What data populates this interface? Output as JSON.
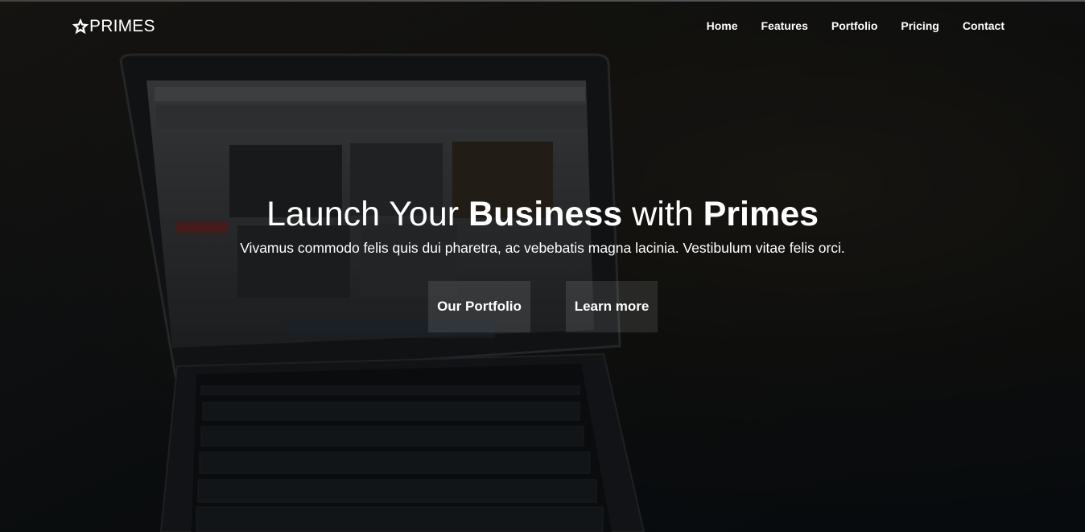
{
  "brand": {
    "name": "PRIMES",
    "icon": "star-icon"
  },
  "nav": {
    "items": [
      {
        "label": "Home"
      },
      {
        "label": "Features"
      },
      {
        "label": "Portfolio"
      },
      {
        "label": "Pricing"
      },
      {
        "label": "Contact"
      }
    ]
  },
  "hero": {
    "headline_parts": [
      "Launch Your ",
      "Business",
      " with ",
      "Primes"
    ],
    "subtitle": "Vivamus commodo felis quis dui pharetra, ac vebebatis magna lacinia. Vestibulum vitae felis orci.",
    "primary_button": "Our Portfolio",
    "secondary_button": "Learn more"
  },
  "colors": {
    "text": "#ffffff",
    "background": "#0b0f14",
    "button_fill": "rgba(255,255,255,0.10)"
  }
}
